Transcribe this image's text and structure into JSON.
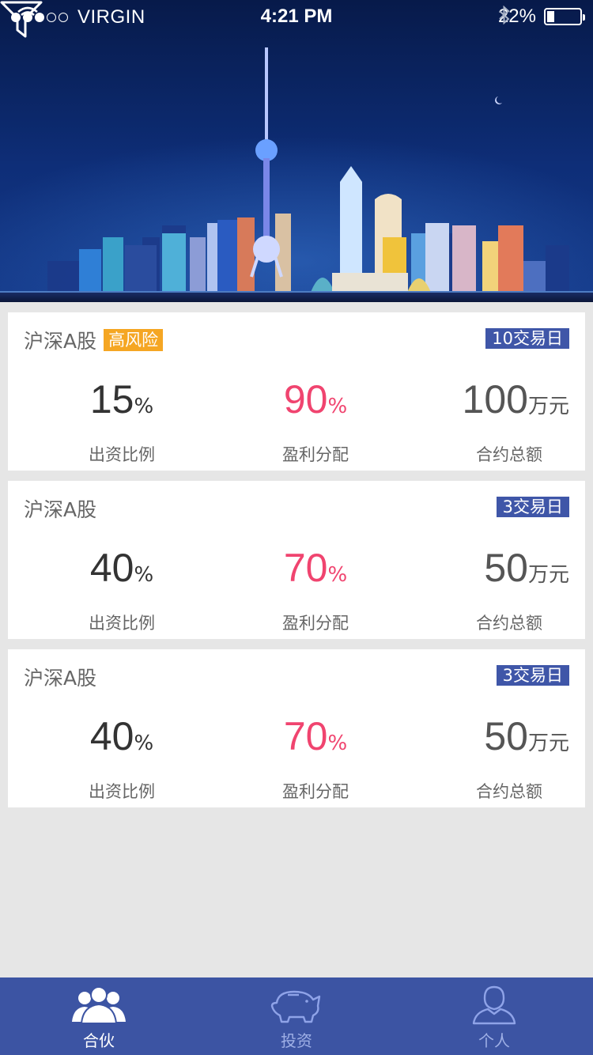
{
  "status_bar": {
    "carrier": "VIRGIN",
    "time": "4:21 PM",
    "battery_text": "22%",
    "battery_level": 0.22
  },
  "hero": {
    "image": "shanghai-night-skyline",
    "filter_icon": "filter-icon"
  },
  "cards": [
    {
      "title": "沪深A股",
      "risk_tag": "高风险",
      "days_tag": "10交易日",
      "investment_ratio": {
        "value": "15",
        "unit": "%",
        "label": "出资比例"
      },
      "profit_share": {
        "value": "90",
        "unit": "%",
        "label": "盈利分配"
      },
      "contract_total": {
        "value": "100",
        "unit": "万元",
        "label": "合约总额"
      }
    },
    {
      "title": "沪深A股",
      "risk_tag": "",
      "days_tag": "3交易日",
      "investment_ratio": {
        "value": "40",
        "unit": "%",
        "label": "出资比例"
      },
      "profit_share": {
        "value": "70",
        "unit": "%",
        "label": "盈利分配"
      },
      "contract_total": {
        "value": "50",
        "unit": "万元",
        "label": "合约总额"
      }
    },
    {
      "title": "沪深A股",
      "risk_tag": "",
      "days_tag": "3交易日",
      "investment_ratio": {
        "value": "40",
        "unit": "%",
        "label": "出资比例"
      },
      "profit_share": {
        "value": "70",
        "unit": "%",
        "label": "盈利分配"
      },
      "contract_total": {
        "value": "50",
        "unit": "万元",
        "label": "合约总额"
      }
    }
  ],
  "tabbar": {
    "tabs": [
      {
        "label": "合伙",
        "icon": "partners-icon",
        "active": true
      },
      {
        "label": "投资",
        "icon": "piggy-bank-icon",
        "active": false
      },
      {
        "label": "个人",
        "icon": "person-icon",
        "active": false
      }
    ]
  },
  "colors": {
    "accent_blue": "#3c54a3",
    "risk_orange": "#f5a623",
    "profit_pink": "#f0446f",
    "background": "#e6e6e6"
  }
}
